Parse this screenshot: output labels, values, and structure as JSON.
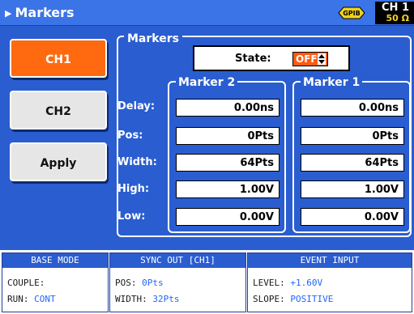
{
  "header": {
    "title": "Markers",
    "gpib_label": "GPIB",
    "channel": "CH 1",
    "impedance": "50 Ω"
  },
  "sidebar": {
    "buttons": [
      {
        "label": "CH1",
        "selected": true
      },
      {
        "label": "CH2",
        "selected": false
      },
      {
        "label": "Apply",
        "selected": false
      }
    ]
  },
  "markers": {
    "group_title": "Markers",
    "state_label": "State:",
    "state_value": "OFF",
    "row_labels": [
      "Delay:",
      "Pos:",
      "Width:",
      "High:",
      "Low:"
    ],
    "marker2": {
      "title": "Marker 2",
      "values": [
        "0.00ns",
        "0Pts",
        "64Pts",
        "1.00V",
        "0.00V"
      ]
    },
    "marker1": {
      "title": "Marker 1",
      "values": [
        "0.00ns",
        "0Pts",
        "64Pts",
        "1.00V",
        "0.00V"
      ]
    }
  },
  "status": {
    "base_mode": {
      "title": "BASE MODE",
      "couple_key": "COUPLE:",
      "couple_val": "",
      "run_key": "RUN:",
      "run_val": "CONT"
    },
    "sync_out": {
      "title": "SYNC OUT [CH1]",
      "pos_key": "POS:",
      "pos_val": "0Pts",
      "width_key": "WIDTH:",
      "width_val": "32Pts"
    },
    "event_input": {
      "title": "EVENT INPUT",
      "level_key": "LEVEL:",
      "level_val": "+1.60V",
      "slope_key": "SLOPE:",
      "slope_val": "POSITIVE"
    }
  },
  "colors": {
    "background": "#2a5dd0",
    "header": "#3b74e6",
    "selected_button": "#ff6a10",
    "value_text_blue": "#1e66ff",
    "impedance_yellow": "#f2d21e"
  }
}
